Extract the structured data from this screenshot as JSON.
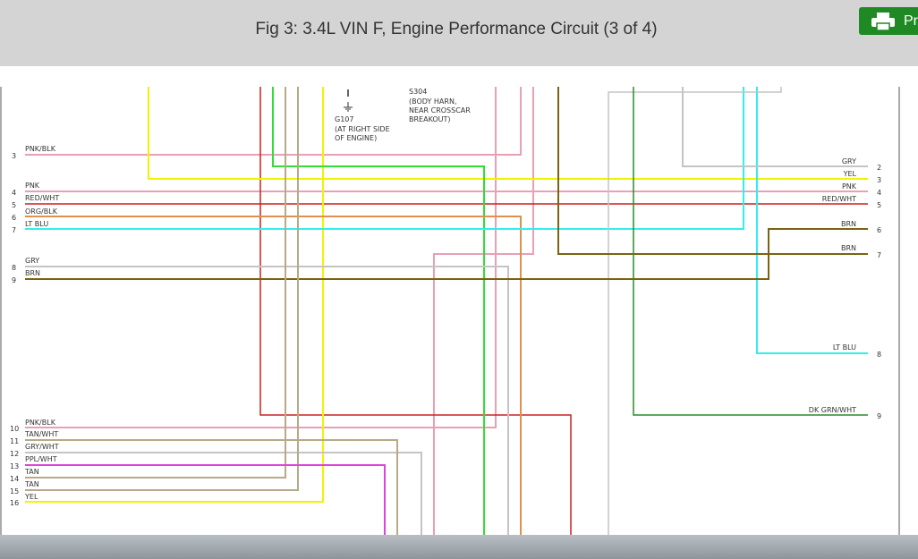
{
  "header": {
    "title": "Fig 3: 3.4L VIN F, Engine Performance Circuit (3 of 4)",
    "print_label": "Pr",
    "print_icon": "printer-icon",
    "button_color": "#1f8a24"
  },
  "diagram": {
    "splice": {
      "id": "S304",
      "lines": [
        "(BODY HARN,",
        "NEAR CROSSCAR",
        "BREAKOUT)"
      ]
    },
    "ground": {
      "id": "G107",
      "lines": [
        "(AT RIGHT SIDE",
        "OF ENGINE)"
      ]
    },
    "left_pins": [
      {
        "pin": "3",
        "label": "PNK/BLK"
      },
      {
        "pin": "4",
        "label": "PNK"
      },
      {
        "pin": "5",
        "label": "RED/WHT"
      },
      {
        "pin": "6",
        "label": "ORG/BLK"
      },
      {
        "pin": "7",
        "label": "LT BLU"
      },
      {
        "pin": "8",
        "label": "GRY"
      },
      {
        "pin": "9",
        "label": "BRN"
      },
      {
        "pin": "10",
        "label": "PNK/BLK"
      },
      {
        "pin": "11",
        "label": "TAN/WHT"
      },
      {
        "pin": "12",
        "label": "GRY/WHT"
      },
      {
        "pin": "13",
        "label": "PPL/WHT"
      },
      {
        "pin": "14",
        "label": "TAN"
      },
      {
        "pin": "15",
        "label": "TAN"
      },
      {
        "pin": "16",
        "label": "YEL"
      }
    ],
    "right_pins": [
      {
        "pin": "2",
        "label": "GRY"
      },
      {
        "pin": "3",
        "label": "YEL"
      },
      {
        "pin": "4",
        "label": "PNK"
      },
      {
        "pin": "5",
        "label": "RED/WHT"
      },
      {
        "pin": "6",
        "label": "BRN"
      },
      {
        "pin": "7",
        "label": "BRN"
      },
      {
        "pin": "8",
        "label": "LT BLU"
      },
      {
        "pin": "9",
        "label": "DK GRN/WHT"
      }
    ],
    "wire_colors": {
      "pink": "#e8a0b4",
      "red": "#cc2020",
      "yellow": "#f2f200",
      "green": "#33dd33",
      "orange": "#dd9050",
      "cyan": "#33eeee",
      "gray": "#c4c4c4",
      "brown": "#7a6310",
      "tan": "#b8aa88",
      "magenta": "#dd44dd",
      "dkgreen": "#2c8a2c"
    }
  }
}
